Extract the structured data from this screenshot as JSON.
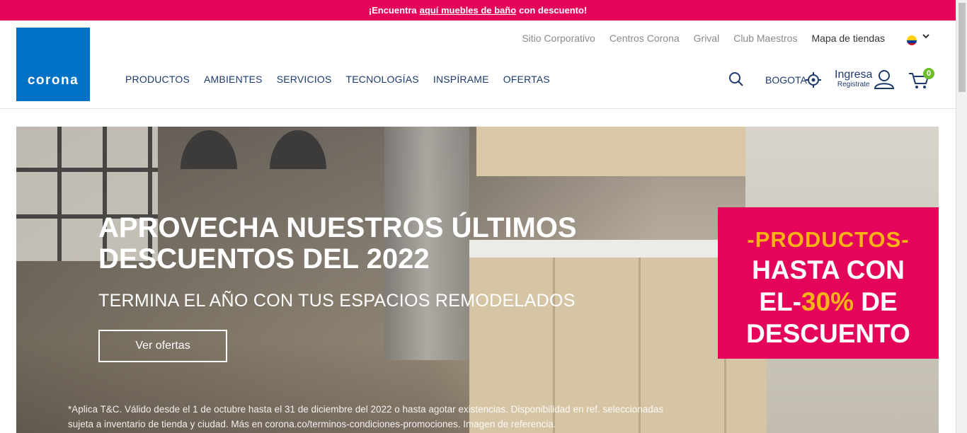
{
  "promo_bar": {
    "text_before": "¡Encuentra",
    "link_text": "aquí muebles de baño",
    "text_after": "con descuento!"
  },
  "header": {
    "logo_text": "corona",
    "util_links": [
      "Sitio Corporativo",
      "Centros Corona",
      "Grival",
      "Club Maestros",
      "Mapa de tiendas"
    ],
    "main_nav": [
      "PRODUCTOS",
      "AMBIENTES",
      "SERVICIOS",
      "TECNOLOGÍAS",
      "INSPÍRAME",
      "OFERTAS"
    ],
    "city": "BOGOTA",
    "login_label": "Ingresa",
    "register_label": "Registrate",
    "cart_count": "0",
    "icons": {
      "search": "search-icon",
      "location": "target-icon",
      "user": "user-icon",
      "cart": "cart-icon",
      "flag": "colombia-flag-icon",
      "chevron": "chevron-down-icon"
    }
  },
  "hero": {
    "title": "APROVECHA NUESTROS ÚLTIMOS DESCUENTOS DEL 2022",
    "subtitle": "TERMINA EL AÑO CON TUS ESPACIOS REMODELADOS",
    "cta_label": "Ver ofertas",
    "disclaimer": "*Aplica T&C. Válido desde el 1 de octubre hasta el 31 de diciembre del 2022 o hasta agotar existencias. Disponibilidad en ref. seleccionadas sujeta a inventario de tienda y ciudad. Más en corona.co/terminos-condiciones-promociones. Imagen de referencia.",
    "promo_box": {
      "line1": "-PRODUCTOS-",
      "line2": "HASTA CON",
      "line3_prefix": "EL-",
      "line3_highlight": "30%",
      "line3_suffix": " DE",
      "line4": "DESCUENTO"
    }
  },
  "colors": {
    "brand_blue": "#0072c6",
    "promo_pink": "#e4055a",
    "highlight_yellow": "#f7b316",
    "nav_blue": "#1c3a6e",
    "badge_green": "#6bbe2c"
  }
}
